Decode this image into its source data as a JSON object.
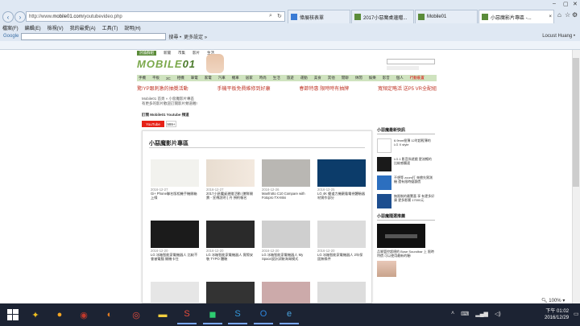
{
  "browser": {
    "url_prefix": "http://www.",
    "url_domain": "mobile01.com",
    "url_path": "/youtubevideo.php",
    "tabs": [
      "偉展核表單",
      "2017小惡魔桌邊贈...",
      "Mobile01",
      "小惡魔影片專區 -..."
    ],
    "menu": [
      "檔案(F)",
      "編輯(E)",
      "檢視(V)",
      "我的最愛(A)",
      "工具(T)",
      "說明(H)"
    ],
    "google_label": "Google",
    "search_btn": "搜尋 •",
    "more_label": "更多設定 »",
    "user": "Locust Huang •"
  },
  "site": {
    "topnav": [
      "討論群組",
      "新聞",
      "市集",
      "影片",
      "生活"
    ],
    "brand_left": "MOBILE",
    "brand_right": "01",
    "catnav": [
      "手機",
      "平板",
      "3C",
      "相機",
      "筆電",
      "家電",
      "汽車",
      "機車",
      "居家",
      "時尚",
      "生活",
      "旅遊",
      "運動",
      "美食",
      "其他",
      "閒聊",
      "休閒",
      "娛樂",
      "影音",
      "個人",
      "行動裝置"
    ],
    "promos": [
      "驚!YP跟刺激的抽獎活動",
      "手機平板免費維修到好康",
      "春節特惠 限時時有抽牌",
      "寬頻定略活 送P5 VR全配組"
    ],
    "crumb1": "Mobile01 首頁 » 小惡魔影片專區",
    "crumb2": "有更多的影片歡迎訂閱影片頻道喔!",
    "subscribe": "訂閱 Mobile01 Youtube 頻道",
    "yt_btn": "YouTube",
    "yt_count": "999+",
    "section_title": "小惡魔影片專區",
    "sidebar_news": "小惡魔最新快訊",
    "sidebar_promo": "小惡魔隨選推薦"
  },
  "videos": [
    {
      "date": "2016-12-27",
      "title": "Gi+ Phone聯名版相機手機開箱上線"
    },
    {
      "date": "2016-12-27",
      "title": "2017小惡魔桌邊贈活動 (搶鮮開賣 - 宣傳說明 ) 丹 預約報名"
    },
    {
      "date": "2016-12-26",
      "title": "Manfrotto C10 Compare with Fotopro TX-Mini"
    },
    {
      "date": "2016-12-25",
      "title": "LG 4K 聲道力機觀看電視體驗器材實作部分"
    },
    {
      "date": "2016-12-20",
      "title": "LG 冰箱智能家電機器人 比較不會被電腦 開機卡住"
    },
    {
      "date": "2016-12-20",
      "title": "LG 冰箱智能家電機器人 實際安裝 TYPO 體驗"
    },
    {
      "date": "2016-12-20",
      "title": "LG 冰箱智能家電機器人 My Space設計試驗海灣模式"
    },
    {
      "date": "2016-12-20",
      "title": "LG 冰箱智能家電機器人 2年保固無條件"
    }
  ],
  "sidebar_items": [
    "6.9mm極薄 12吋超輕薄的 LG X style",
    "LG.1 影音與遊戲 更流暢的 比較感觸速",
    "不想等 zoom打 來搶先實測機 還有限時優惠價",
    "無限制的最驚喜 享 有更多好康 更多影響 17000元"
  ],
  "sidebar_promo_text": "品質管控超規的 Bose Soundbar 上 限時特價 可以使用最新的喔!",
  "status": {
    "zoom": "100%",
    "time": "下午 01:02",
    "date": "2016/12/29"
  },
  "colors": {
    "brand_green": "#7aa84a",
    "nav_green": "#cfe3bf",
    "promo_red": "#c0392b",
    "taskbar": "#1c2333"
  }
}
